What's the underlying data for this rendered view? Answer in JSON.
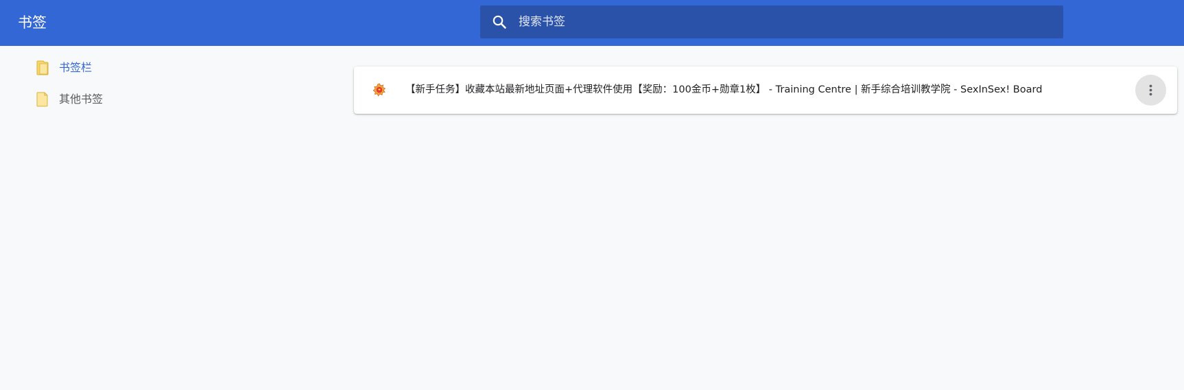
{
  "header": {
    "title": "书签",
    "accent_color": "#3367d6"
  },
  "search": {
    "placeholder": "搜索书签",
    "value": "",
    "icon": "search-icon"
  },
  "sidebar": {
    "items": [
      {
        "label": "书签栏",
        "icon": "folder-open-icon",
        "selected": true
      },
      {
        "label": "其他书签",
        "icon": "folder-icon",
        "selected": false
      }
    ]
  },
  "bookmarks": [
    {
      "title": "【新手任务】收藏本站最新地址页面+代理软件使用【奖励：100金币+勋章1枚】 - Training Centre | 新手综合培训教学院 - SexInSex! Board",
      "icon": "site-favicon",
      "menu_icon": "more-vert-icon"
    }
  ]
}
